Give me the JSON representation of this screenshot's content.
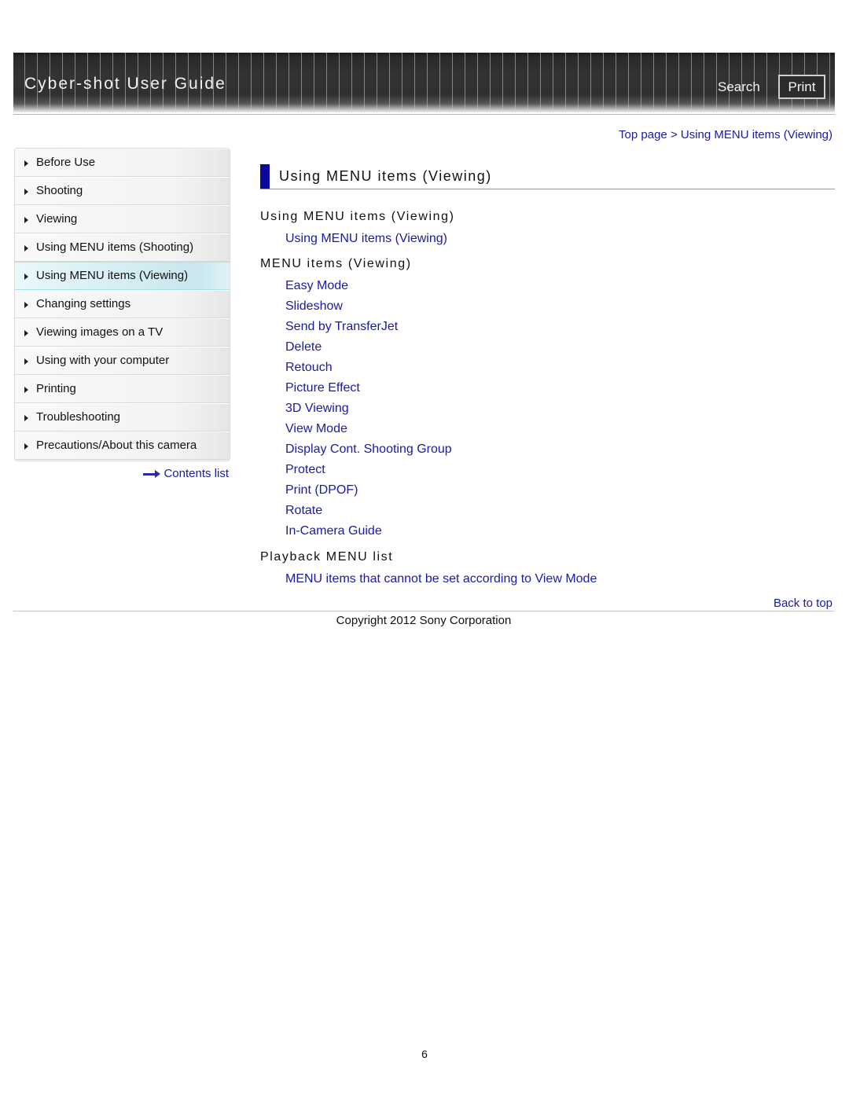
{
  "header": {
    "title": "Cyber-shot User Guide",
    "search_label": "Search",
    "print_label": "Print"
  },
  "breadcrumb": {
    "text": "Top page > Using MENU items (Viewing)",
    "items": [
      "Top page",
      "Using MENU items (Viewing)"
    ],
    "separator": ">"
  },
  "sidebar": {
    "items": [
      {
        "label": "Before Use",
        "active": false
      },
      {
        "label": "Shooting",
        "active": false
      },
      {
        "label": "Viewing",
        "active": false
      },
      {
        "label": "Using MENU items (Shooting)",
        "active": false
      },
      {
        "label": "Using MENU items (Viewing)",
        "active": true
      },
      {
        "label": "Changing settings",
        "active": false
      },
      {
        "label": "Viewing images on a TV",
        "active": false
      },
      {
        "label": "Using with your computer",
        "active": false
      },
      {
        "label": "Printing",
        "active": false
      },
      {
        "label": "Troubleshooting",
        "active": false
      },
      {
        "label": "Precautions/About this camera",
        "active": false
      }
    ],
    "contents_list_label": "Contents list"
  },
  "main": {
    "heading": "Using MENU items (Viewing)",
    "sections": [
      {
        "title": "Using MENU items (Viewing)",
        "links": [
          "Using MENU items (Viewing)"
        ]
      },
      {
        "title": "MENU items (Viewing)",
        "links": [
          "Easy Mode",
          "Slideshow",
          "Send by TransferJet",
          "Delete",
          "Retouch",
          "Picture Effect",
          "3D Viewing",
          "View Mode",
          "Display Cont. Shooting Group",
          "Protect",
          "Print (DPOF)",
          "Rotate",
          "In-Camera Guide"
        ]
      },
      {
        "title": "Playback MENU list",
        "links": [
          "MENU items that cannot be set according to View Mode"
        ]
      }
    ],
    "back_to_top": "Back to top"
  },
  "footer": {
    "copyright": "Copyright 2012 Sony Corporation",
    "page_number": "6"
  },
  "colors": {
    "link": "#1a1aa6",
    "heading_bar": "#0a0a9a",
    "active_nav_bg": "#d5eef3",
    "banner_bg": "#333333"
  }
}
